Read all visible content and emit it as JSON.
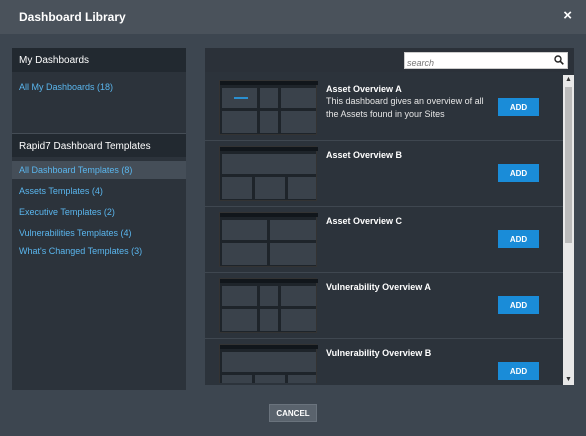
{
  "dialog": {
    "title": "Dashboard Library",
    "close_symbol": "×"
  },
  "sidebar": {
    "my_heading": "My Dashboards",
    "my_items": [
      {
        "label": "All My Dashboards (18)"
      }
    ],
    "templates_heading": "Rapid7 Dashboard Templates",
    "template_items": [
      {
        "label": "All Dashboard Templates (8)",
        "selected": true
      },
      {
        "label": "Assets Templates (4)"
      },
      {
        "label": "Executive Templates (2)"
      },
      {
        "label": "Vulnerabilities Templates (4)"
      },
      {
        "label": "What's Changed Templates (3)"
      }
    ]
  },
  "search": {
    "placeholder": "search",
    "icon": "magnifier"
  },
  "templates": [
    {
      "name": "Asset Overview A",
      "description": "This dashboard gives an overview of all the Assets found in your Sites",
      "add_label": "ADD"
    },
    {
      "name": "Asset Overview B",
      "description": "",
      "add_label": "ADD"
    },
    {
      "name": "Asset Overview C",
      "description": "",
      "add_label": "ADD"
    },
    {
      "name": "Vulnerability Overview A",
      "description": "",
      "add_label": "ADD"
    },
    {
      "name": "Vulnerability Overview B",
      "description": "",
      "add_label": "ADD"
    }
  ],
  "footer": {
    "cancel_label": "CANCEL"
  },
  "colors": {
    "accent": "#1a8cd8",
    "link": "#5ab6ee",
    "panel": "#2c333b",
    "background": "#3d4650"
  }
}
